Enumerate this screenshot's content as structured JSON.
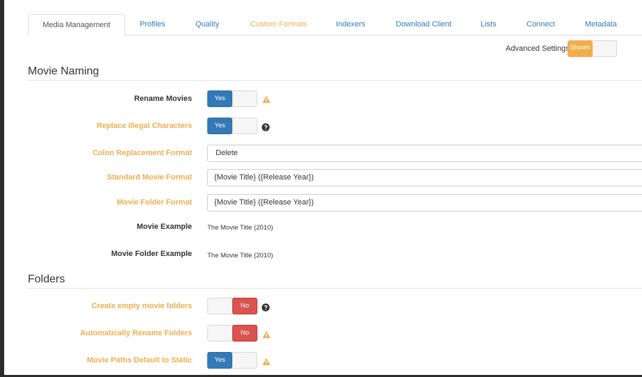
{
  "tabs": [
    {
      "label": "Media Management",
      "active": true
    },
    {
      "label": "Profiles"
    },
    {
      "label": "Quality"
    },
    {
      "label": "Custom Formats",
      "warn": true
    },
    {
      "label": "Indexers"
    },
    {
      "label": "Download Client"
    },
    {
      "label": "Lists"
    },
    {
      "label": "Connect"
    },
    {
      "label": "Metadata"
    }
  ],
  "advanced": {
    "label": "Advanced Settings",
    "state": "Shown"
  },
  "sections": {
    "naming": "Movie Naming",
    "folders": "Folders"
  },
  "naming": {
    "rename_movies": {
      "label": "Rename Movies",
      "value": "Yes"
    },
    "replace_illegal": {
      "label": "Replace Illegal Characters",
      "value": "Yes"
    },
    "colon_replacement": {
      "label": "Colon Replacement Format",
      "value": "Delete"
    },
    "standard_format": {
      "label": "Standard Movie Format",
      "value": "{Movie Title} ({Release Year})"
    },
    "folder_format": {
      "label": "Movie Folder Format",
      "value": "{Movie Title} ({Release Year})"
    },
    "movie_example": {
      "label": "Movie Example",
      "value": "The Movie Title (2010)"
    },
    "folder_example": {
      "label": "Movie Folder Example",
      "value": "The Movie Title (2010)"
    }
  },
  "folders": {
    "create_empty": {
      "label": "Create empty movie folders",
      "value": "No"
    },
    "auto_rename": {
      "label": "Automatically Rename Folders",
      "value": "No"
    },
    "paths_static": {
      "label": "Movie Paths Default to Static",
      "value": "Yes"
    }
  },
  "colors": {
    "primary": "#337ab7",
    "warning": "#f0ad4e",
    "danger": "#d9534f"
  }
}
